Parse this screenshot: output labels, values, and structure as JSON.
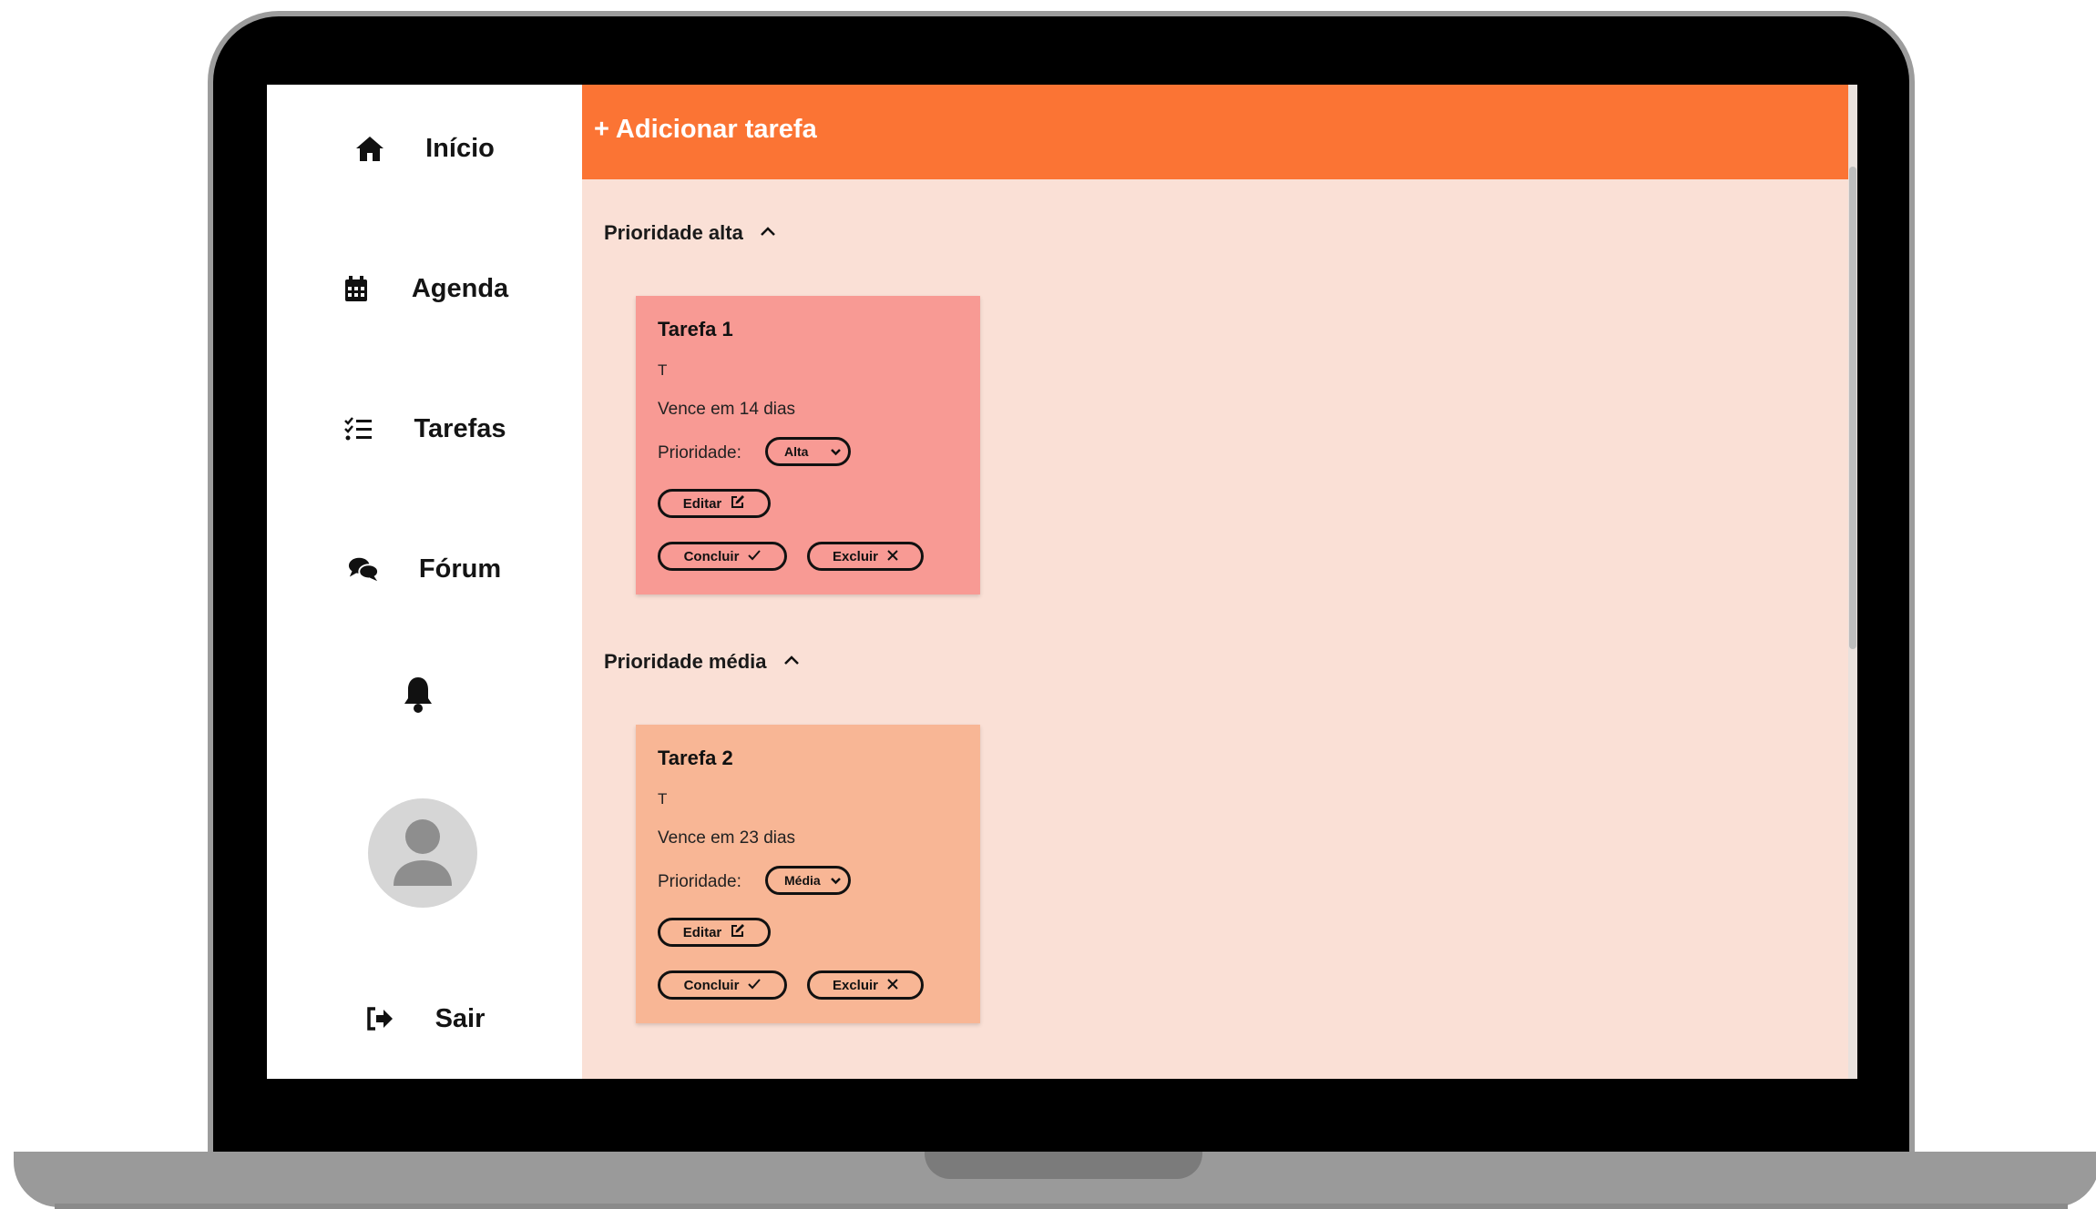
{
  "sidebar": {
    "items": [
      {
        "label": "Início",
        "icon": "home-icon"
      },
      {
        "label": "Agenda",
        "icon": "calendar-icon"
      },
      {
        "label": "Tarefas",
        "icon": "task-list-icon"
      },
      {
        "label": "Fórum",
        "icon": "comments-icon"
      }
    ],
    "notifications_icon": "bell-icon",
    "avatar_icon": "user-avatar-icon",
    "logout": {
      "label": "Sair",
      "icon": "sign-out-icon"
    }
  },
  "header": {
    "add_task_label": "+ Adicionar tarefa"
  },
  "colors": {
    "accent": "#fb7434",
    "background": "#fae0d6",
    "card_high": "#f89a94",
    "card_medium": "#f8b695"
  },
  "sections": [
    {
      "title": "Prioridade alta",
      "tasks": [
        {
          "title": "Tarefa 1",
          "description": "T",
          "due": "Vence em 14 dias",
          "priority_label": "Prioridade:",
          "priority_value": "Alta",
          "edit_label": "Editar",
          "complete_label": "Concluir",
          "delete_label": "Excluir"
        }
      ]
    },
    {
      "title": "Prioridade média",
      "tasks": [
        {
          "title": "Tarefa 2",
          "description": "T",
          "due": "Vence em 23 dias",
          "priority_label": "Prioridade:",
          "priority_value": "Média",
          "edit_label": "Editar",
          "complete_label": "Concluir",
          "delete_label": "Excluir"
        }
      ]
    }
  ]
}
